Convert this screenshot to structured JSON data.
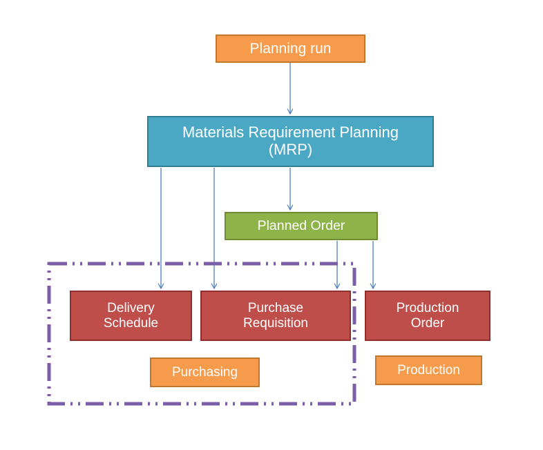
{
  "diagram": {
    "title": "Materials Requirement Planning process flow",
    "background": "#FFFFFF",
    "palette": {
      "orange_fill": "#F59B4B",
      "orange_border": "#C0762B",
      "teal_fill": "#4AA8C4",
      "teal_border": "#2E7D93",
      "green_fill": "#8EB449",
      "green_border": "#6E8B34",
      "red_fill": "#BF4E4B",
      "red_border": "#8E2F2C",
      "connector_blue": "#4A7EBB",
      "connector_green": "#8EB449",
      "group_purple": "#7B5EA7"
    },
    "nodes": [
      {
        "id": "planning-run",
        "label": "Planning run",
        "color": "orange"
      },
      {
        "id": "mrp",
        "label": "Materials Requirement Planning\n(MRP)",
        "color": "teal"
      },
      {
        "id": "planned-order",
        "label": "Planned Order",
        "color": "green"
      },
      {
        "id": "delivery-schedule",
        "label": "Delivery\nSchedule",
        "color": "red"
      },
      {
        "id": "purchase-requisition",
        "label": "Purchase\nRequisition",
        "color": "red"
      },
      {
        "id": "production-order",
        "label": "Production\nOrder",
        "color": "red"
      },
      {
        "id": "purchasing",
        "label": "Purchasing",
        "color": "orange"
      },
      {
        "id": "production",
        "label": "Production",
        "color": "orange"
      }
    ],
    "connectors": [
      {
        "from": "planning-run",
        "to": "mrp",
        "style": "solid-arrow",
        "color": "#4A7EBB"
      },
      {
        "from": "mrp",
        "to": "delivery-schedule",
        "style": "solid-arrow",
        "color": "#4A7EBB"
      },
      {
        "from": "mrp",
        "to": "purchase-requisition",
        "style": "solid-arrow",
        "color": "#4A7EBB"
      },
      {
        "from": "mrp",
        "to": "planned-order",
        "style": "solid-arrow",
        "color": "#4A7EBB"
      },
      {
        "from": "planned-order",
        "to": "purchase-requisition",
        "style": "solid-arrow",
        "color": "#4A7EBB"
      },
      {
        "from": "planned-order",
        "to": "production-order",
        "style": "solid-arrow",
        "color": "#4A7EBB"
      }
    ],
    "groups": [
      {
        "id": "purchasing-region",
        "style": "dash-dot-dot",
        "color": "#7B5EA7",
        "contains": [
          "delivery-schedule",
          "purchase-requisition",
          "purchasing"
        ]
      }
    ]
  }
}
